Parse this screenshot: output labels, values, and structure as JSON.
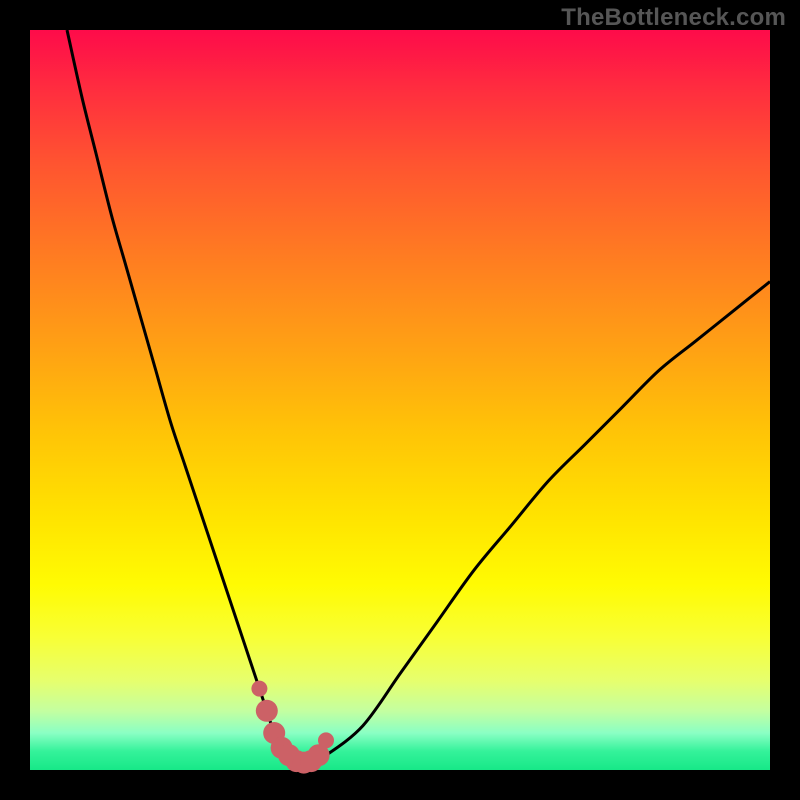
{
  "watermark": "TheBottleneck.com",
  "colors": {
    "background_outer": "#000000",
    "gradient_top": "#fe0b4a",
    "gradient_bottom": "#17e888",
    "curve_stroke": "#000000",
    "marker_fill": "#cc6166"
  },
  "chart_data": {
    "type": "line",
    "title": "",
    "xlabel": "",
    "ylabel": "",
    "xlim": [
      0,
      100
    ],
    "ylim": [
      0,
      100
    ],
    "series": [
      {
        "name": "bottleneck-curve",
        "x": [
          5,
          7,
          9,
          11,
          13,
          15,
          17,
          19,
          21,
          23,
          25,
          27,
          29,
          31,
          32,
          33,
          34,
          35,
          36,
          37,
          38,
          40,
          45,
          50,
          55,
          60,
          65,
          70,
          75,
          80,
          85,
          90,
          95,
          100
        ],
        "y": [
          100,
          91,
          83,
          75,
          68,
          61,
          54,
          47,
          41,
          35,
          29,
          23,
          17,
          11,
          8,
          5,
          3,
          2,
          1.2,
          1,
          1.2,
          2,
          6,
          13,
          20,
          27,
          33,
          39,
          44,
          49,
          54,
          58,
          62,
          66
        ]
      }
    ],
    "markers": {
      "name": "optimum-zone",
      "color": "#cc6166",
      "x": [
        31,
        32,
        33,
        34,
        35,
        36,
        37,
        38,
        39,
        40
      ],
      "y": [
        11,
        8,
        5,
        3,
        2,
        1.2,
        1,
        1.2,
        2,
        4
      ]
    },
    "annotations": []
  }
}
